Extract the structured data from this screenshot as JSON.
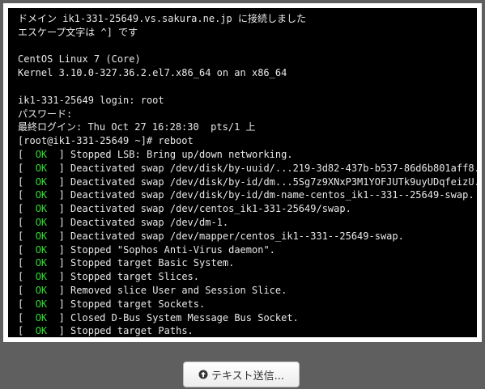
{
  "console": {
    "lines": [
      {
        "type": "text",
        "text": "ドメイン ik1-331-25649.vs.sakura.ne.jp に接続しました"
      },
      {
        "type": "text",
        "text": "エスケープ文字は ^] です"
      },
      {
        "type": "text",
        "text": ""
      },
      {
        "type": "text",
        "text": "CentOS Linux 7 (Core)"
      },
      {
        "type": "text",
        "text": "Kernel 3.10.0-327.36.2.el7.x86_64 on an x86_64"
      },
      {
        "type": "text",
        "text": ""
      },
      {
        "type": "text",
        "text": "ik1-331-25649 login: root"
      },
      {
        "type": "text",
        "text": "パスワード:"
      },
      {
        "type": "text",
        "text": "最終ログイン: Thu Oct 27 16:28:30  pts/1 上"
      },
      {
        "type": "text",
        "text": "[root@ik1-331-25649 ~]# reboot"
      },
      {
        "type": "status",
        "open": "[  ",
        "status": "OK",
        "close": "  ] ",
        "message": "Stopped LSB: Bring up/down networking."
      },
      {
        "type": "status",
        "open": "[  ",
        "status": "OK",
        "close": "  ] ",
        "message": "Deactivated swap /dev/disk/by-uuid/...219-3d82-437b-b537-86d6b801aff8."
      },
      {
        "type": "status",
        "open": "[  ",
        "status": "OK",
        "close": "  ] ",
        "message": "Deactivated swap /dev/disk/by-id/dm...5Sg7z9XNxP3M1YOFJUTk9uyUDqfeizU."
      },
      {
        "type": "status",
        "open": "[  ",
        "status": "OK",
        "close": "  ] ",
        "message": "Deactivated swap /dev/disk/by-id/dm-name-centos_ik1--331--25649-swap."
      },
      {
        "type": "status",
        "open": "[  ",
        "status": "OK",
        "close": "  ] ",
        "message": "Deactivated swap /dev/centos_ik1-331-25649/swap."
      },
      {
        "type": "status",
        "open": "[  ",
        "status": "OK",
        "close": "  ] ",
        "message": "Deactivated swap /dev/dm-1."
      },
      {
        "type": "status",
        "open": "[  ",
        "status": "OK",
        "close": "  ] ",
        "message": "Deactivated swap /dev/mapper/centos_ik1--331--25649-swap."
      },
      {
        "type": "status",
        "open": "[  ",
        "status": "OK",
        "close": "  ] ",
        "message": "Stopped \"Sophos Anti-Virus daemon\"."
      },
      {
        "type": "status",
        "open": "[  ",
        "status": "OK",
        "close": "  ] ",
        "message": "Stopped target Basic System."
      },
      {
        "type": "status",
        "open": "[  ",
        "status": "OK",
        "close": "  ] ",
        "message": "Stopped target Slices."
      },
      {
        "type": "status",
        "open": "[  ",
        "status": "OK",
        "close": "  ] ",
        "message": "Removed slice User and Session Slice."
      },
      {
        "type": "status",
        "open": "[  ",
        "status": "OK",
        "close": "  ] ",
        "message": "Stopped target Sockets."
      },
      {
        "type": "status",
        "open": "[  ",
        "status": "OK",
        "close": "  ] ",
        "message": "Closed D-Bus System Message Bus Socket."
      },
      {
        "type": "status",
        "open": "[  ",
        "status": "OK",
        "close": "  ] ",
        "message": "Stopped target Paths."
      }
    ]
  },
  "footer": {
    "send_button_label": "テキスト送信...",
    "send_button_icon": "upload-circle-icon"
  },
  "colors": {
    "background": "#5f5f5f",
    "console_background": "#000000",
    "console_text": "#e8e8e8",
    "ok_status": "#33dd33"
  }
}
